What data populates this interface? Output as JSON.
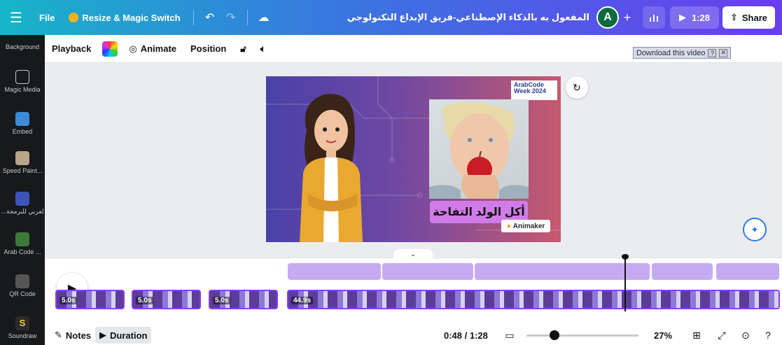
{
  "topbar": {
    "file_label": "File",
    "resize_label": "Resize & Magic Switch",
    "document_title": "المفعول به بالذكاء الإصطناعي-فريق الإبداع التكنولوجي",
    "avatar_initial": "A",
    "play_duration": "1:28",
    "share_label": "Share"
  },
  "sidebar": {
    "items": [
      {
        "label": "Background"
      },
      {
        "label": "Magic Media"
      },
      {
        "label": "Embed"
      },
      {
        "label": "Speed Paint..."
      },
      {
        "label": "...لعربي للبرمجة"
      },
      {
        "label": "Arab Code ..."
      },
      {
        "label": "QR Code"
      },
      {
        "label": "Soundraw"
      }
    ]
  },
  "context_toolbar": {
    "playback_label": "Playback",
    "animate_label": "Animate",
    "position_label": "Position",
    "download_video_label": "Download this video"
  },
  "slide": {
    "badge_line1": "ArabCode",
    "badge_line2": "Week 2024",
    "caption": "أكل الولد التفاحة",
    "logo_text": "Animaker"
  },
  "timeline": {
    "clips": [
      {
        "duration": "5.0s"
      },
      {
        "duration": "5.0s"
      },
      {
        "duration": "5.0s"
      },
      {
        "duration": "44.9s"
      }
    ]
  },
  "bottombar": {
    "notes_label": "Notes",
    "duration_label": "Duration",
    "time_current": "0:48",
    "time_total": "1:28",
    "time_separator": " / ",
    "zoom_percent": "27%",
    "zoom_level": 0.27
  },
  "colors": {
    "accent": "#8b3dff",
    "topbar_start": "#17b4c9",
    "topbar_end": "#6a3df0",
    "caption_bg": "#d17be8",
    "sidebar_bg": "#18191b"
  },
  "icons": [
    "menu-icon",
    "crown-icon",
    "undo-icon",
    "redo-icon",
    "cloud-saved-icon",
    "plus-icon",
    "stats-icon",
    "play-icon",
    "share-icon",
    "color-palette-icon",
    "animate-icon",
    "lock-icon",
    "volume-icon",
    "refresh-icon",
    "magic-sparkle-icon",
    "chevron-down-icon",
    "notes-icon",
    "duration-icon",
    "page-icon",
    "grid-icon",
    "fullscreen-icon",
    "check-circle-icon",
    "help-icon"
  ]
}
